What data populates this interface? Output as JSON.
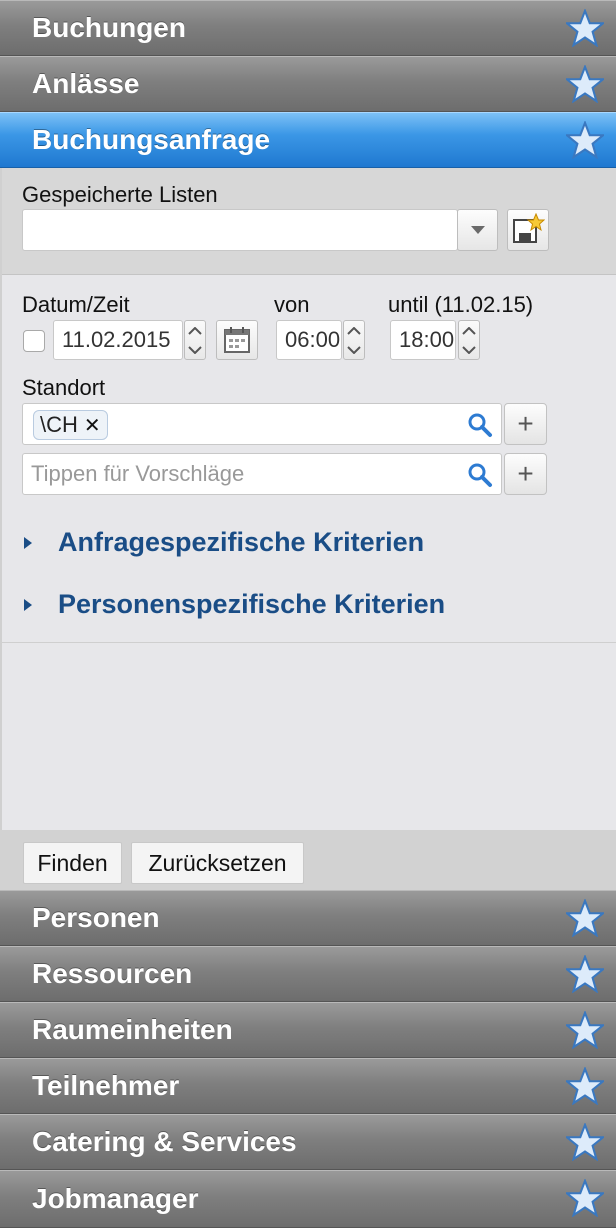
{
  "accordion_top": [
    {
      "label": "Buchungen",
      "icon": "star-icon"
    },
    {
      "label": "Anlässe",
      "icon": "star-icon"
    },
    {
      "label": "Buchungsanfrage",
      "icon": "star-icon",
      "active": true
    }
  ],
  "saved_lists": {
    "label": "Gespeicherte Listen",
    "value": ""
  },
  "datetime": {
    "label": "Datum/Zeit",
    "date_value": "11.02.2015",
    "from_label": "von",
    "from_value": "06:00",
    "until_label": "until (11.02.15)",
    "until_value": "18:00"
  },
  "location": {
    "label": "Standort",
    "token": "\\CH",
    "placeholder": "Tippen für Vorschläge"
  },
  "criteria": [
    {
      "label": "Anfragespezifische Kriterien"
    },
    {
      "label": "Personenspezifische Kriterien"
    }
  ],
  "actions": {
    "find": "Finden",
    "reset": "Zurücksetzen"
  },
  "accordion_bottom": [
    {
      "label": "Personen"
    },
    {
      "label": "Ressourcen"
    },
    {
      "label": "Raumeinheiten"
    },
    {
      "label": "Teilnehmer"
    },
    {
      "label": "Catering & Services"
    },
    {
      "label": "Jobmanager"
    }
  ],
  "colors": {
    "header_gray": "#7f7f7f",
    "header_active_blue": "#3b97e6",
    "link_blue": "#1a4d86"
  }
}
